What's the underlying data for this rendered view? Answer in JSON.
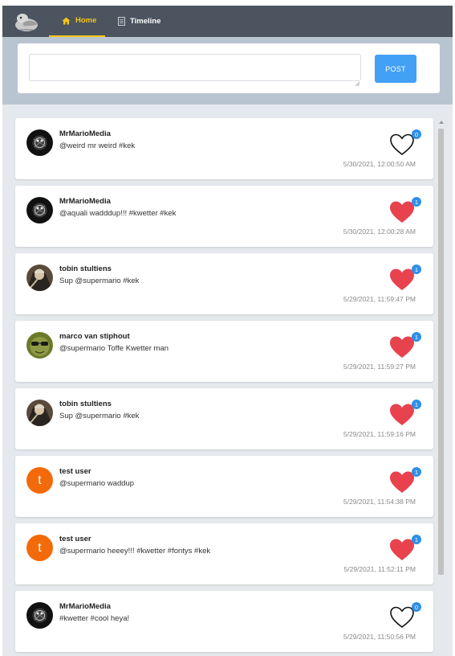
{
  "nav": {
    "logo_icon": "pigeon-logo-icon",
    "tabs": [
      {
        "label": "Home",
        "icon": "home-icon",
        "active": true
      },
      {
        "label": "Timeline",
        "icon": "document-icon",
        "active": false
      }
    ]
  },
  "composer": {
    "value": "",
    "post_label": "POST"
  },
  "colors": {
    "navbar": "#4b545f",
    "active_tab": "#f5c518",
    "post_button": "#42a0f5",
    "liked_heart": "#e8424f",
    "badge": "#2f8fe8"
  },
  "posts": [
    {
      "user": "MrMarioMedia",
      "message": "@weird mr weird #kek",
      "time": "5/30/2021, 12:00:50 AM",
      "likes": "0",
      "liked": false,
      "avatar": "dark"
    },
    {
      "user": "MrMarioMedia",
      "message": "@aquali wadddup!!! #kwetter #kek",
      "time": "5/30/2021, 12:00:28 AM",
      "likes": "1",
      "liked": true,
      "avatar": "dark"
    },
    {
      "user": "tobin stultiens",
      "message": "Sup @supermario #kek",
      "time": "5/29/2021, 11:59:47 PM",
      "likes": "1",
      "liked": true,
      "avatar": "tobin"
    },
    {
      "user": "marco van stiphout",
      "message": "@supermario Toffe Kwetter man",
      "time": "5/29/2021, 11:59:27 PM",
      "likes": "1",
      "liked": true,
      "avatar": "marco"
    },
    {
      "user": "tobin stultiens",
      "message": "Sup @supermario #kek",
      "time": "5/29/2021, 11:59:16 PM",
      "likes": "1",
      "liked": true,
      "avatar": "tobin"
    },
    {
      "user": "test user",
      "message": "@supermario waddup",
      "time": "5/29/2021, 11:54:38 PM",
      "likes": "1",
      "liked": true,
      "avatar": "letter",
      "initial": "t"
    },
    {
      "user": "test user",
      "message": "@supermario heeey!!! #kwetter #fontys #kek",
      "time": "5/29/2021, 11:52:11 PM",
      "likes": "1",
      "liked": true,
      "avatar": "letter",
      "initial": "t"
    },
    {
      "user": "MrMarioMedia",
      "message": "#kwetter #cool heya!",
      "time": "5/29/2021, 11:50:56 PM",
      "likes": "0",
      "liked": false,
      "avatar": "dark"
    }
  ]
}
